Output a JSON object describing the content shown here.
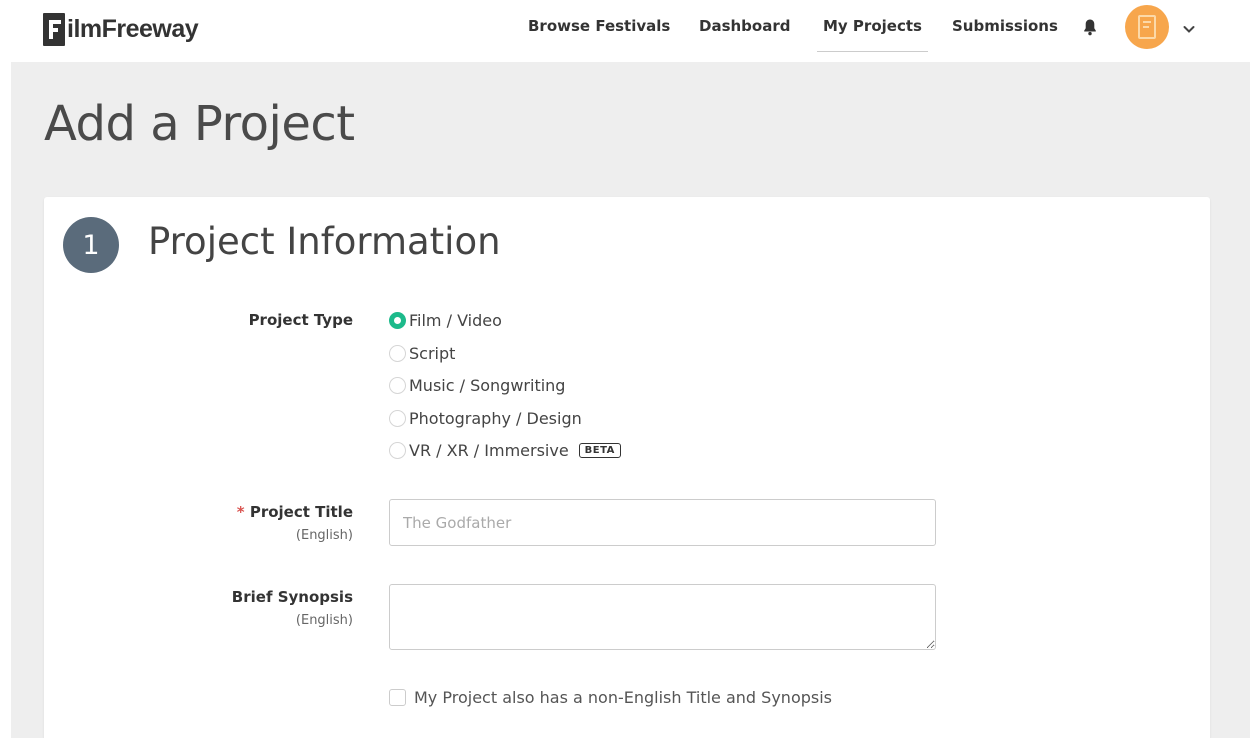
{
  "header": {
    "logo_text": "ilmFreeway",
    "nav": [
      {
        "label": "Browse Festivals"
      },
      {
        "label": "Dashboard"
      },
      {
        "label": "My Projects"
      },
      {
        "label": "Submissions"
      }
    ],
    "icons": {
      "notifications": "bell-icon",
      "avatar": "filmfreeway-avatar-icon",
      "menu": "chevron-down-icon"
    }
  },
  "page": {
    "title": "Add a Project"
  },
  "section": {
    "number": "1",
    "title": "Project Information"
  },
  "form": {
    "project_type": {
      "label": "Project Type",
      "options": [
        {
          "label": "Film / Video",
          "checked": true
        },
        {
          "label": "Script",
          "checked": false
        },
        {
          "label": "Music / Songwriting",
          "checked": false
        },
        {
          "label": "Photography / Design",
          "checked": false
        },
        {
          "label": "VR / XR / Immersive",
          "checked": false,
          "badge": "BETA"
        }
      ]
    },
    "project_title": {
      "required_mark": "*",
      "label": "Project Title",
      "sub": "(English)",
      "placeholder": "The Godfather",
      "value": ""
    },
    "synopsis": {
      "label": "Brief Synopsis",
      "sub": "(English)",
      "value": ""
    },
    "non_english": {
      "label": "My Project also has a non-English Title and Synopsis",
      "checked": false
    }
  },
  "colors": {
    "accent": "#1dba8b",
    "avatar": "#f7a64c",
    "step_circle": "#5a6b7b",
    "required": "#d9534f",
    "page_bg": "#eeeeee"
  }
}
